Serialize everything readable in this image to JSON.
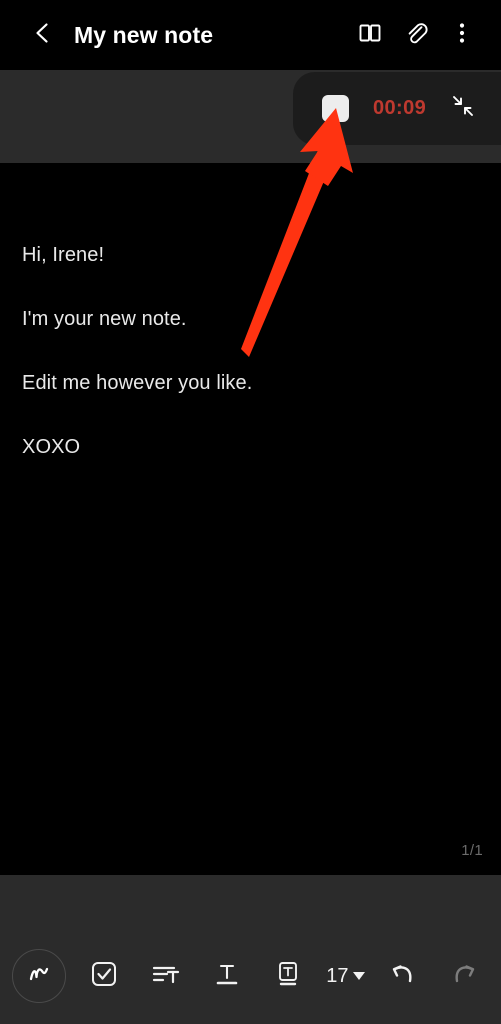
{
  "appbar": {
    "back_icon": "chevron-left-icon",
    "title": "My new note",
    "actions": [
      {
        "icon": "book-icon",
        "name": "reading-mode-button"
      },
      {
        "icon": "paperclip-icon",
        "name": "attachment-button"
      },
      {
        "icon": "more-vertical-icon",
        "name": "overflow-menu-button"
      }
    ]
  },
  "recording": {
    "stop_button_label": "",
    "timer": "00:09",
    "timer_color": "#bf392f",
    "collapse_icon": "collapse-arrows-icon"
  },
  "note": {
    "lines": [
      "Hi, Irene!",
      "I'm your new note.",
      "Edit me however you like.",
      "XOXO"
    ],
    "page_indicator": "1/1"
  },
  "annotation": {
    "arrow_color": "#FF3311",
    "points_at": "recording-stop-button"
  },
  "toolbar": {
    "items": [
      {
        "name": "handwriting-button",
        "icon": "pen-scribble-icon",
        "label": ""
      },
      {
        "name": "checklist-button",
        "icon": "checkbox-icon",
        "label": ""
      },
      {
        "name": "paragraph-style-button",
        "icon": "text-align-icon",
        "label": ""
      },
      {
        "name": "text-format-button",
        "icon": "underline-t-icon",
        "label": ""
      },
      {
        "name": "text-box-button",
        "icon": "boxed-t-icon",
        "label": ""
      },
      {
        "name": "font-size-button",
        "icon": "chevron-down-icon",
        "label": "17"
      },
      {
        "name": "undo-button",
        "icon": "undo-arrow-icon",
        "label": ""
      },
      {
        "name": "redo-button",
        "icon": "redo-arrow-icon",
        "label": ""
      }
    ],
    "font_size_value": "17"
  },
  "colors": {
    "background": "#000000",
    "panel": "#2b2b2b",
    "pill": "#1c1c1c",
    "text": "#e9e9e9",
    "dim_text": "#6b6b6b",
    "accent_red": "#bf392f",
    "annotation_red": "#FF3311"
  }
}
